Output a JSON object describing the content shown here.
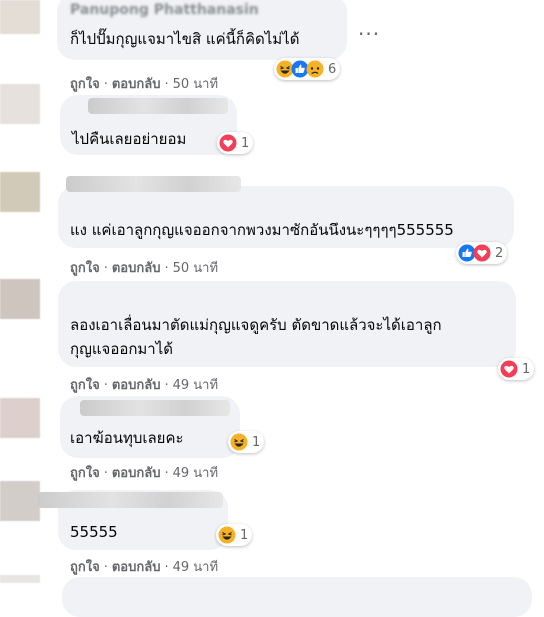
{
  "actions": {
    "like": "ถูกใจ",
    "reply": "ตอบกลับ",
    "sep": "·"
  },
  "comments": [
    {
      "name": "Panupong Phatthanasin",
      "text": "ก็ไปปั๊มกุญแจมาไขสิ แค่นี้ก็คิดไม่ได้",
      "time": "50 นาที",
      "reactions": [
        "haha",
        "like",
        "sad"
      ],
      "count": "6"
    },
    {
      "text": "ไปคืนเลยอย่ายอม",
      "reactions": [
        "love"
      ],
      "count": "1"
    },
    {
      "text": "แง แค่เอาลูกกุญแจออกจากพวงมาซักอันนึงนะๆๆๆๆ555555",
      "time": "50 นาที",
      "reactions": [
        "like",
        "love"
      ],
      "count": "2"
    },
    {
      "text1": "ลองเอาเลื่อนมาตัดแม่กุญแจดูครับ ตัดขาดแล้วจะได้เอาลูก",
      "text2": "กุญแจออกมาได้",
      "time": "49 นาที",
      "reactions": [
        "love"
      ],
      "count": "1"
    },
    {
      "text": "เอาฆ้อนทุบเลยคะ",
      "time": "49 นาที",
      "reactions": [
        "haha"
      ],
      "count": "1"
    },
    {
      "text": "55555",
      "time": "49 นาที",
      "reactions": [
        "haha"
      ],
      "count": "1"
    }
  ],
  "colors": {
    "bubble": "#f0f2f5",
    "secondary_text": "#65676b",
    "like_blue": "#1877f2",
    "love_red": "#f33e58",
    "haha_yellow": "#f7b125"
  }
}
